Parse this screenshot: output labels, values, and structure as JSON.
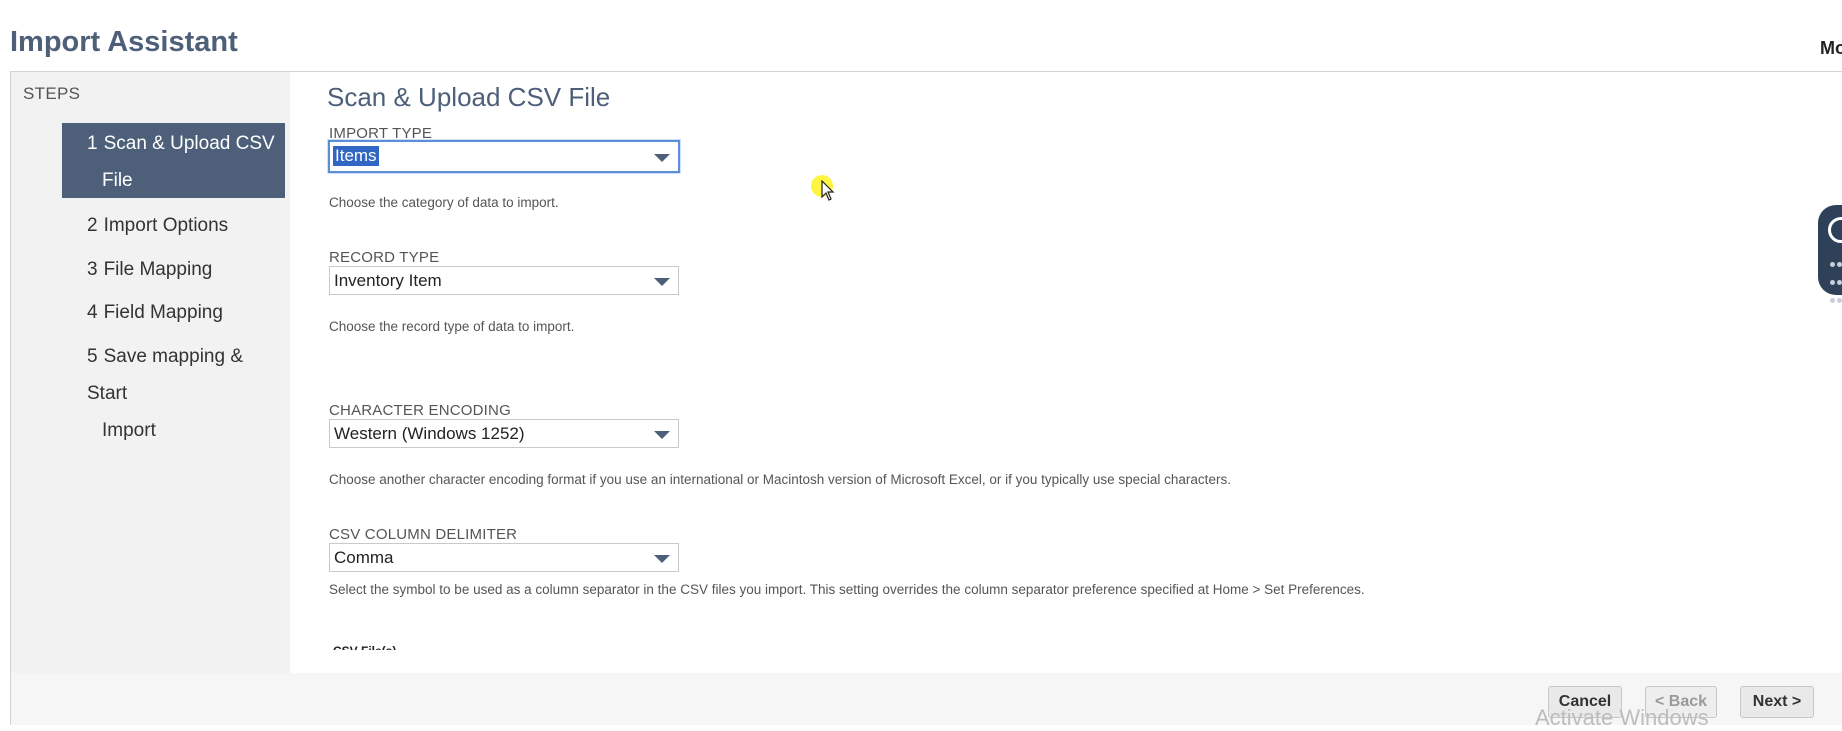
{
  "header": {
    "title": "Import Assistant",
    "top_right_text": "Mo"
  },
  "steps": {
    "header": "STEPS",
    "items": [
      {
        "num": "1",
        "label": "Scan & Upload CSV",
        "label2": "File",
        "active": true
      },
      {
        "num": "2",
        "label": "Import Options"
      },
      {
        "num": "3",
        "label": "File Mapping"
      },
      {
        "num": "4",
        "label": "Field Mapping"
      },
      {
        "num": "5",
        "label": "Save mapping & Start",
        "label2": "Import"
      }
    ]
  },
  "main": {
    "title": "Scan & Upload CSV File",
    "fields": [
      {
        "label": "IMPORT TYPE",
        "value": "Items",
        "help": "Choose the category of data to import.",
        "focused": true
      },
      {
        "label": "RECORD TYPE",
        "value": "Inventory Item",
        "help": "Choose the record type of data to import."
      },
      {
        "label": "CHARACTER ENCODING",
        "value": "Western (Windows 1252)",
        "help": "Choose another character encoding format if you use an international or Macintosh version of Microsoft Excel, or if you typically use special characters."
      },
      {
        "label": "CSV COLUMN DELIMITER",
        "value": "Comma",
        "help": "Select the symbol to be used as a column separator in the CSV files you import. This setting overrides the column separator preference specified at Home > Set Preferences."
      }
    ],
    "partial_label": "CSV File(s)"
  },
  "footer": {
    "cancel": "Cancel",
    "back": "< Back",
    "next": "Next >",
    "watermark": "Activate Windows"
  },
  "colors": {
    "accent": "#4d5f79",
    "selection": "#3166c4",
    "focus_border": "#5b8ed6",
    "panel_bg": "#f2f2f2"
  },
  "icons": {
    "dropdown": "chevron-down-icon",
    "cursor": "mouse-pointer-icon",
    "help_widget": "help-icon"
  }
}
